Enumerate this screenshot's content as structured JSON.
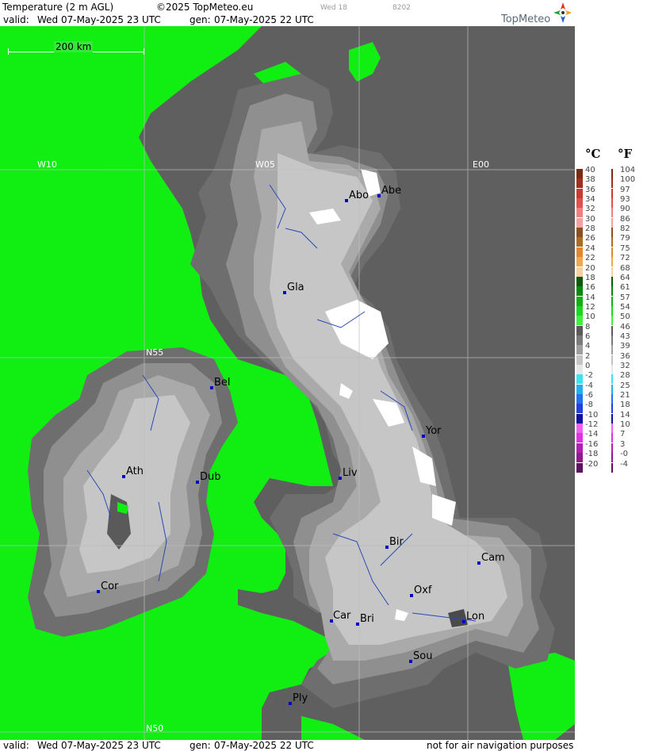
{
  "header": {
    "title": "Temperature (2 m AGL)",
    "copyright": "©2025 TopMeteo.eu",
    "day_code": "Wed 18",
    "code": "8202",
    "valid_label": "valid:",
    "valid_value": "Wed  07-May-2025  23 UTC",
    "gen_label": "gen:",
    "gen_value": "07-May-2025 22 UTC",
    "brand": "TopMeteo"
  },
  "map": {
    "scale_label": "200 km",
    "grid_labels": [
      "W10",
      "W05",
      "E00",
      "N55",
      "N50"
    ],
    "cities": [
      {
        "name": "Abo"
      },
      {
        "name": "Abe"
      },
      {
        "name": "Gla"
      },
      {
        "name": "Bel"
      },
      {
        "name": "Yor"
      },
      {
        "name": "Ath"
      },
      {
        "name": "Dub"
      },
      {
        "name": "Liv"
      },
      {
        "name": "Bir"
      },
      {
        "name": "Cam"
      },
      {
        "name": "Cor"
      },
      {
        "name": "Oxf"
      },
      {
        "name": "Car"
      },
      {
        "name": "Bri"
      },
      {
        "name": "Lon"
      },
      {
        "name": "Sou"
      },
      {
        "name": "Ply"
      }
    ],
    "colors": {
      "sea": "#5f5f5f",
      "band_10_12": "#11ee11",
      "band_8": "#6e6e6e",
      "band_6": "#8f8f8f",
      "band_4": "#aaaaaa",
      "band_2": "#c6c6c6",
      "band_0": "#ffffff",
      "city_marker": "#0000cc"
    }
  },
  "legend": {
    "unit_c": "°C",
    "unit_f": "°F",
    "items": [
      {
        "c": "40",
        "f": "104",
        "color": "#7a2a10"
      },
      {
        "c": "38",
        "f": "100",
        "color": "#a0301c"
      },
      {
        "c": "36",
        "f": "97",
        "color": "#c83c2c"
      },
      {
        "c": "34",
        "f": "93",
        "color": "#e05050"
      },
      {
        "c": "32",
        "f": "90",
        "color": "#f08080"
      },
      {
        "c": "30",
        "f": "86",
        "color": "#f4a0a0"
      },
      {
        "c": "28",
        "f": "82",
        "color": "#8a5020"
      },
      {
        "c": "26",
        "f": "79",
        "color": "#b06a24"
      },
      {
        "c": "24",
        "f": "75",
        "color": "#e08830"
      },
      {
        "c": "22",
        "f": "72",
        "color": "#f0a850"
      },
      {
        "c": "20",
        "f": "68",
        "color": "#f8d0a0"
      },
      {
        "c": "18",
        "f": "64",
        "color": "#0a5a0a"
      },
      {
        "c": "16",
        "f": "61",
        "color": "#0a8a0a"
      },
      {
        "c": "14",
        "f": "57",
        "color": "#12b012"
      },
      {
        "c": "12",
        "f": "54",
        "color": "#1ad81a"
      },
      {
        "c": "10",
        "f": "50",
        "color": "#40f040"
      },
      {
        "c": "8",
        "f": "46",
        "color": "#5a5a5a"
      },
      {
        "c": "6",
        "f": "43",
        "color": "#7a7a7a"
      },
      {
        "c": "4",
        "f": "39",
        "color": "#9e9e9e"
      },
      {
        "c": "2",
        "f": "36",
        "color": "#c4c4c4"
      },
      {
        "c": "0",
        "f": "32",
        "color": "#e6e6e6"
      },
      {
        "c": "-2",
        "f": "28",
        "color": "#40e0f0"
      },
      {
        "c": "-4",
        "f": "25",
        "color": "#20b0f0"
      },
      {
        "c": "-6",
        "f": "21",
        "color": "#2070f0"
      },
      {
        "c": "-8",
        "f": "18",
        "color": "#2040e0"
      },
      {
        "c": "-10",
        "f": "14",
        "color": "#1010a0"
      },
      {
        "c": "-12",
        "f": "10",
        "color": "#f060f0"
      },
      {
        "c": "-14",
        "f": "7",
        "color": "#e030e0"
      },
      {
        "c": "-16",
        "f": "3",
        "color": "#b020b0"
      },
      {
        "c": "-18",
        "f": "-0",
        "color": "#901890"
      },
      {
        "c": "-20",
        "f": "-4",
        "color": "#601060"
      }
    ]
  },
  "footer": {
    "valid_label": "valid:",
    "valid_value": "Wed  07-May-2025  23 UTC",
    "gen_label": "gen:",
    "gen_value": "07-May-2025 22 UTC",
    "disclaimer": "not for air navigation purposes"
  }
}
